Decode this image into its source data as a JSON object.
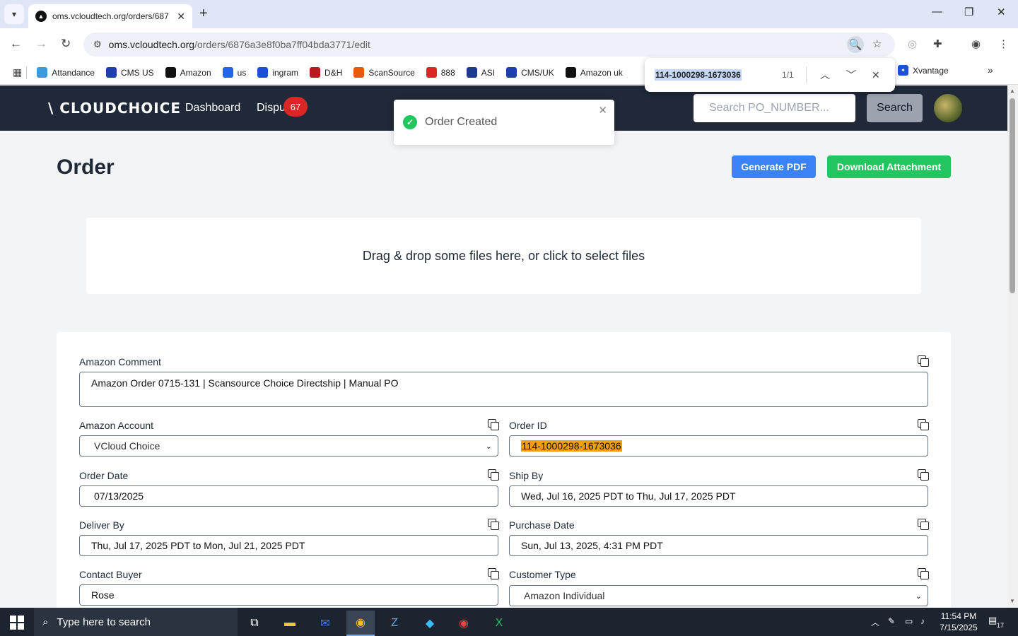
{
  "browser": {
    "tab_title": "oms.vcloudtech.org/orders/687",
    "url_host": "oms.vcloudtech.org",
    "url_path": "/orders/6876a3e8f0ba7ff04bda3771/edit"
  },
  "bookmarks": {
    "items": [
      {
        "label": "Attandance",
        "color": "#3b9ad9"
      },
      {
        "label": "CMS US",
        "color": "#1e40af"
      },
      {
        "label": "Amazon",
        "color": "#111111"
      },
      {
        "label": "us",
        "color": "#2563eb"
      },
      {
        "label": "ingram",
        "color": "#1d4ed8"
      },
      {
        "label": "D&H",
        "color": "#b91c1c"
      },
      {
        "label": "ScanSource",
        "color": "#ea580c"
      },
      {
        "label": "888",
        "color": "#dc2626"
      },
      {
        "label": "ASI",
        "color": "#1e3a8a"
      },
      {
        "label": "CMS/UK",
        "color": "#1e40af"
      },
      {
        "label": "Amazon uk",
        "color": "#111111"
      }
    ],
    "right_item": "Xvantage"
  },
  "findbar": {
    "query": "114-1000298-1673036",
    "count": "1/1"
  },
  "header": {
    "logo": "\\ CLOUDCHOICE",
    "nav": [
      "Dashboard",
      "Dispu"
    ],
    "badge": "67",
    "search_placeholder": "Search PO_NUMBER...",
    "search_button": "Search"
  },
  "toast": {
    "message": "Order Created"
  },
  "page": {
    "title": "Order",
    "generate_pdf": "Generate PDF",
    "download_attachment": "Download Attachment",
    "dropzone": "Drag & drop some files here, or click to select files"
  },
  "form": {
    "amazon_comment_label": "Amazon Comment",
    "amazon_comment_value": "Amazon Order 0715-131 | Scansource Choice Directship | Manual PO",
    "amazon_account_label": "Amazon Account",
    "amazon_account_value": "VCloud Choice",
    "order_id_label": "Order ID",
    "order_id_value": "114-1000298-1673036",
    "order_date_label": "Order Date",
    "order_date_value": "07/13/2025",
    "ship_by_label": "Ship By",
    "ship_by_value": "Wed, Jul 16, 2025 PDT to Thu, Jul 17, 2025 PDT",
    "deliver_by_label": "Deliver By",
    "deliver_by_value": "Thu, Jul 17, 2025 PDT to Mon, Jul 21, 2025 PDT",
    "purchase_date_label": "Purchase Date",
    "purchase_date_value": "Sun, Jul 13, 2025, 4:31 PM PDT",
    "contact_buyer_label": "Contact Buyer",
    "contact_buyer_value": "Rose",
    "customer_type_label": "Customer Type",
    "customer_type_value": "Amazon Individual"
  },
  "taskbar": {
    "search_placeholder": "Type here to search",
    "time": "11:54 PM",
    "date": "7/15/2025",
    "notifications": "17"
  }
}
